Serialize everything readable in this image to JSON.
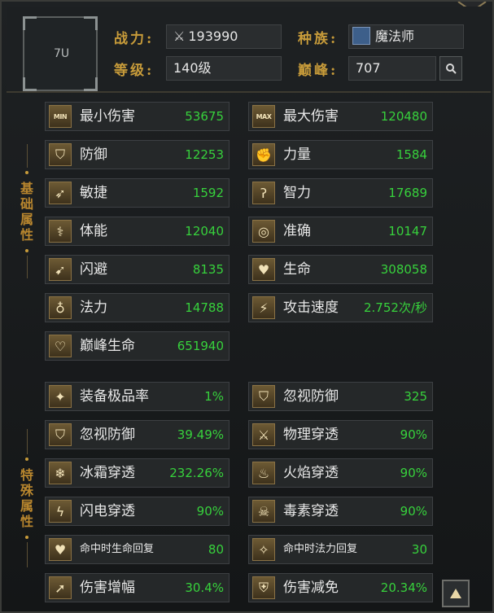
{
  "header": {
    "avatar_label": "7U",
    "power_label": "战力:",
    "power_value": "193990",
    "race_label": "种族:",
    "race_value": "魔法师",
    "level_label": "等级:",
    "level_value": "140级",
    "peak_label": "巅峰:",
    "peak_value": "707"
  },
  "side_labels": {
    "basic": "基础属性",
    "special": "特殊属性"
  },
  "basic_stats": [
    {
      "name": "最小伤害",
      "value": "53675",
      "icon": "min-damage-icon"
    },
    {
      "name": "最大伤害",
      "value": "120480",
      "icon": "max-damage-icon"
    },
    {
      "name": "防御",
      "value": "12253",
      "icon": "shield-icon"
    },
    {
      "name": "力量",
      "value": "1584",
      "icon": "fist-icon"
    },
    {
      "name": "敏捷",
      "value": "1592",
      "icon": "agility-icon"
    },
    {
      "name": "智力",
      "value": "17689",
      "icon": "intellect-icon"
    },
    {
      "name": "体能",
      "value": "12040",
      "icon": "muscle-icon"
    },
    {
      "name": "准确",
      "value": "10147",
      "icon": "target-icon"
    },
    {
      "name": "闪避",
      "value": "8135",
      "icon": "dodge-icon"
    },
    {
      "name": "生命",
      "value": "308058",
      "icon": "heart-icon"
    },
    {
      "name": "法力",
      "value": "14788",
      "icon": "mana-potion-icon"
    },
    {
      "name": "攻击速度",
      "value": "2.752次/秒",
      "icon": "attack-speed-icon"
    },
    {
      "name": "巅峰生命",
      "value": "651940",
      "icon": "peak-heart-icon"
    }
  ],
  "special_stats": [
    {
      "name": "装备极品率",
      "value": "1%",
      "icon": "equipment-icon"
    },
    {
      "name": "忽视防御",
      "value": "325",
      "icon": "ignore-defense-icon"
    },
    {
      "name": "忽视防御",
      "value": "39.49%",
      "icon": "ignore-defense-pct-icon"
    },
    {
      "name": "物理穿透",
      "value": "90%",
      "icon": "physical-pierce-icon"
    },
    {
      "name": "冰霜穿透",
      "value": "232.26%",
      "icon": "frost-pierce-icon"
    },
    {
      "name": "火焰穿透",
      "value": "90%",
      "icon": "fire-pierce-icon"
    },
    {
      "name": "闪电穿透",
      "value": "90%",
      "icon": "lightning-pierce-icon"
    },
    {
      "name": "毒素穿透",
      "value": "90%",
      "icon": "poison-pierce-icon"
    },
    {
      "name": "命中时生命回复",
      "value": "80",
      "icon": "hp-on-hit-icon"
    },
    {
      "name": "命中时法力回复",
      "value": "30",
      "icon": "mp-on-hit-icon"
    },
    {
      "name": "伤害增幅",
      "value": "30.4%",
      "icon": "damage-amp-icon"
    },
    {
      "name": "伤害减免",
      "value": "20.34%",
      "icon": "damage-reduce-icon"
    }
  ],
  "icon_text": {
    "min": "MIN",
    "max": "MAX"
  },
  "colors": {
    "label_gold": "#c79b3a",
    "value_green": "#37d13c"
  }
}
